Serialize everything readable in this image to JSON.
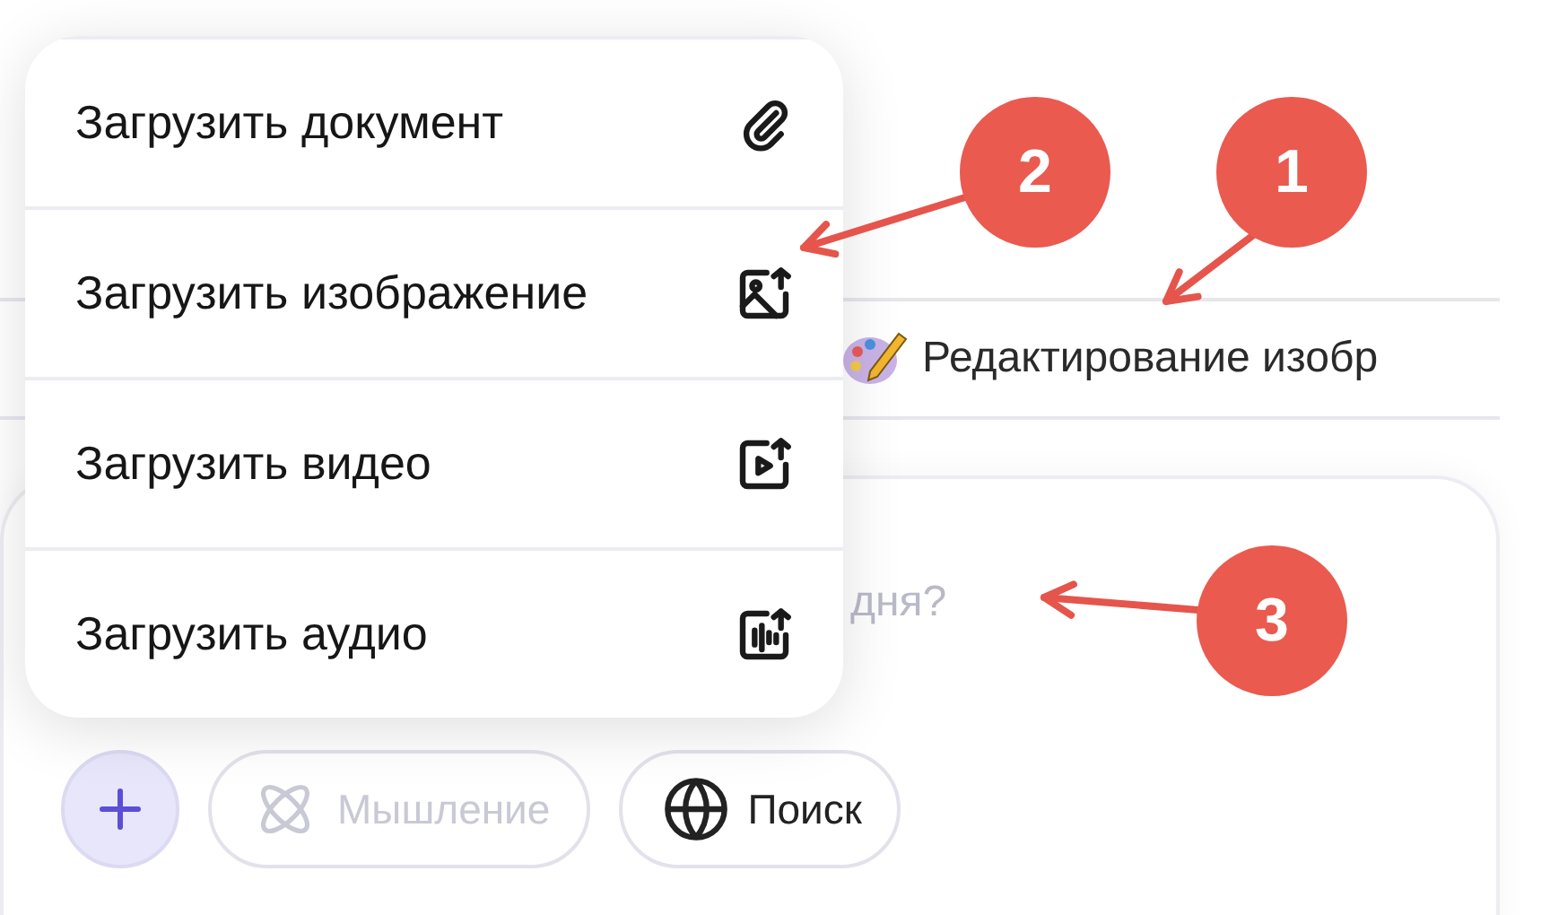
{
  "attach_menu": {
    "items": [
      {
        "label": "Загрузить документ",
        "kind": "document"
      },
      {
        "label": "Загрузить изображение",
        "kind": "image"
      },
      {
        "label": "Загрузить видео",
        "kind": "video"
      },
      {
        "label": "Загрузить аудио",
        "kind": "audio"
      }
    ]
  },
  "suggestion_chip": {
    "label": "Редактирование изобр"
  },
  "composer": {
    "placeholder": "дня?",
    "buttons": [
      {
        "kind": "add"
      },
      {
        "kind": "thinking",
        "label": "Мышление",
        "disabled": true
      },
      {
        "kind": "search",
        "label": "Поиск",
        "disabled": false
      }
    ]
  },
  "annotations": [
    {
      "label": "1"
    },
    {
      "label": "2"
    },
    {
      "label": "3"
    }
  ]
}
